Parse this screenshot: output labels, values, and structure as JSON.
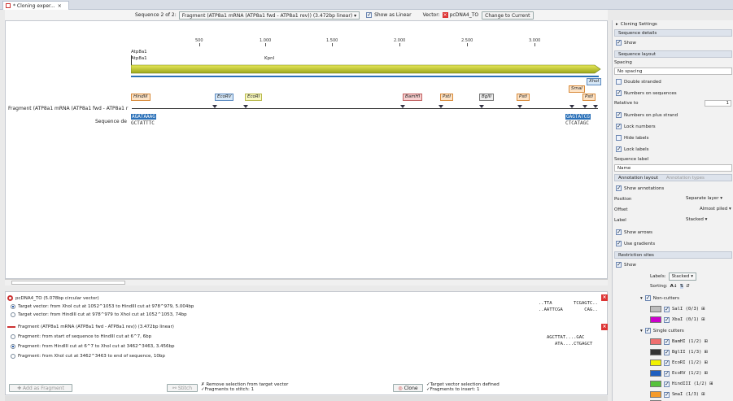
{
  "tab": {
    "title": "* Cloning exper...",
    "close": "×"
  },
  "toolbar": {
    "sequence_prefix": "Sequence 2 of 2:",
    "sequence_select": "Fragment (ATP8a1 mRNA (ATP8a1 fwd - ATP8a1 rev)) (3.472bp linear)",
    "show_as_linear": "Show as Linear",
    "vector_label": "Vector:",
    "vector_name": "pcDNA4_TO",
    "change_button": "Change to Current"
  },
  "ruler": [
    "500",
    "1.000",
    "1.500",
    "2.000",
    "2.500",
    "3.000"
  ],
  "annotations": {
    "atp1": "Atp8a1",
    "atp2": "Atp8a1",
    "kpni": "KpnI"
  },
  "features": [
    "HindIII",
    "EcoRV",
    "EcoRI",
    "BamHI",
    "PstI",
    "BglII",
    "PstI",
    "SmaI",
    "PstI",
    "XhoI"
  ],
  "fragment_label": "Fragment (ATP8a1 mRNA (ATP8a1 fwd - ATP8a1 r",
  "seq_label": "Sequence de",
  "seq_left_top": "AGATAAAG",
  "seq_left_bottom": "GCTATTTC",
  "seq_right_top": "GAGTATCG",
  "seq_right_bottom": "CTCATAGC",
  "vector_section": {
    "title": "pcDNA4_TO (5.078bp circular vector)",
    "options": [
      "Target vector: from XhoI cut at 1052^1053 to HindIII cut at 978^979, 5.004bp",
      "Target vector: from HindIII cut at 978^979 to XhoI cut at 1052^1053, 74bp"
    ],
    "seq1a": "..TTA        TCGAGTC..",
    "seq1b": "..AATTCGA        CAG.."
  },
  "fragment_section": {
    "title": "Fragment (ATP8a1 mRNA (ATP8a1 fwd - ATP8a1 rev)) (3.472bp linear)",
    "options": [
      "Fragment: from start of sequence to HindIII cut at 6^7, 6bp",
      "Fragment: from HindIII cut at 6^7 to XhoI cut at 3462^3463, 3.456bp",
      "Fragment: from XhoI cut at 3462^3463 to end of sequence, 10bp"
    ],
    "seq2a": "AGCTTAT....GAC",
    "seq2b": "ATA....CTGAGCT"
  },
  "bottom_buttons": {
    "add_fragment": "Add as Fragment",
    "stitch": "Stitch",
    "stitch_note1": "✗ Remove selection from target vector",
    "stitch_note2": "✓Fragments to stitch: 1",
    "clone": "Clone",
    "clone_note1": "✓Target vector selection defined",
    "clone_note2": "✓Fragments to insert: 1"
  },
  "side": {
    "title": "Cloning Settings",
    "seq_details": "Sequence details",
    "show": "Show",
    "seq_layout": "Sequence layout",
    "spacing": "Spacing",
    "no_spacing": "No spacing",
    "double_stranded": "Double stranded",
    "numbers_on_sequences": "Numbers on sequences",
    "relative_to": "Relative to",
    "relative_value": "1",
    "numbers_plus": "Numbers on plus strand",
    "lock_numbers": "Lock numbers",
    "hide_labels": "Hide labels",
    "lock_labels": "Lock labels",
    "sequence_label": "Sequence label",
    "name": "Name",
    "annotation_layout": "Annotation layout",
    "annotation_types": "Annotation types",
    "show_annotations": "Show annotations",
    "position": "Position",
    "position_val": "Separate layer",
    "offset": "Offset",
    "offset_val": "Almost piled",
    "label": "Label",
    "label_val": "Stacked",
    "show_arrows": "Show arrows",
    "use_gradients": "Use gradients",
    "restriction_sites": "Restriction sites",
    "rs_show": "Show",
    "labels": "Labels:",
    "labels_val": "Stacked",
    "sorting": "Sorting:",
    "non_cutters": "Non-cutters",
    "single_cutters": "Single cutters",
    "enzymes": [
      {
        "name": "SalI (0/3)",
        "color": "#bdbdbd"
      },
      {
        "name": "XbaI (0/1)",
        "color": "#cc00cc"
      },
      {
        "name": "BamHI (1/2)",
        "color": "#f07070"
      },
      {
        "name": "BglII (1/3)",
        "color": "#333333"
      },
      {
        "name": "EcoRI (1/2)",
        "color": "#f2f200"
      },
      {
        "name": "EcoRV (1/2)",
        "color": "#1f5fbf"
      },
      {
        "name": "HindIII (1/2)",
        "color": "#57c23b"
      },
      {
        "name": "SmaI (1/3)",
        "color": "#f49a2a"
      },
      {
        "name": "XhoI (1/3)",
        "color": "#22aadd"
      }
    ]
  }
}
